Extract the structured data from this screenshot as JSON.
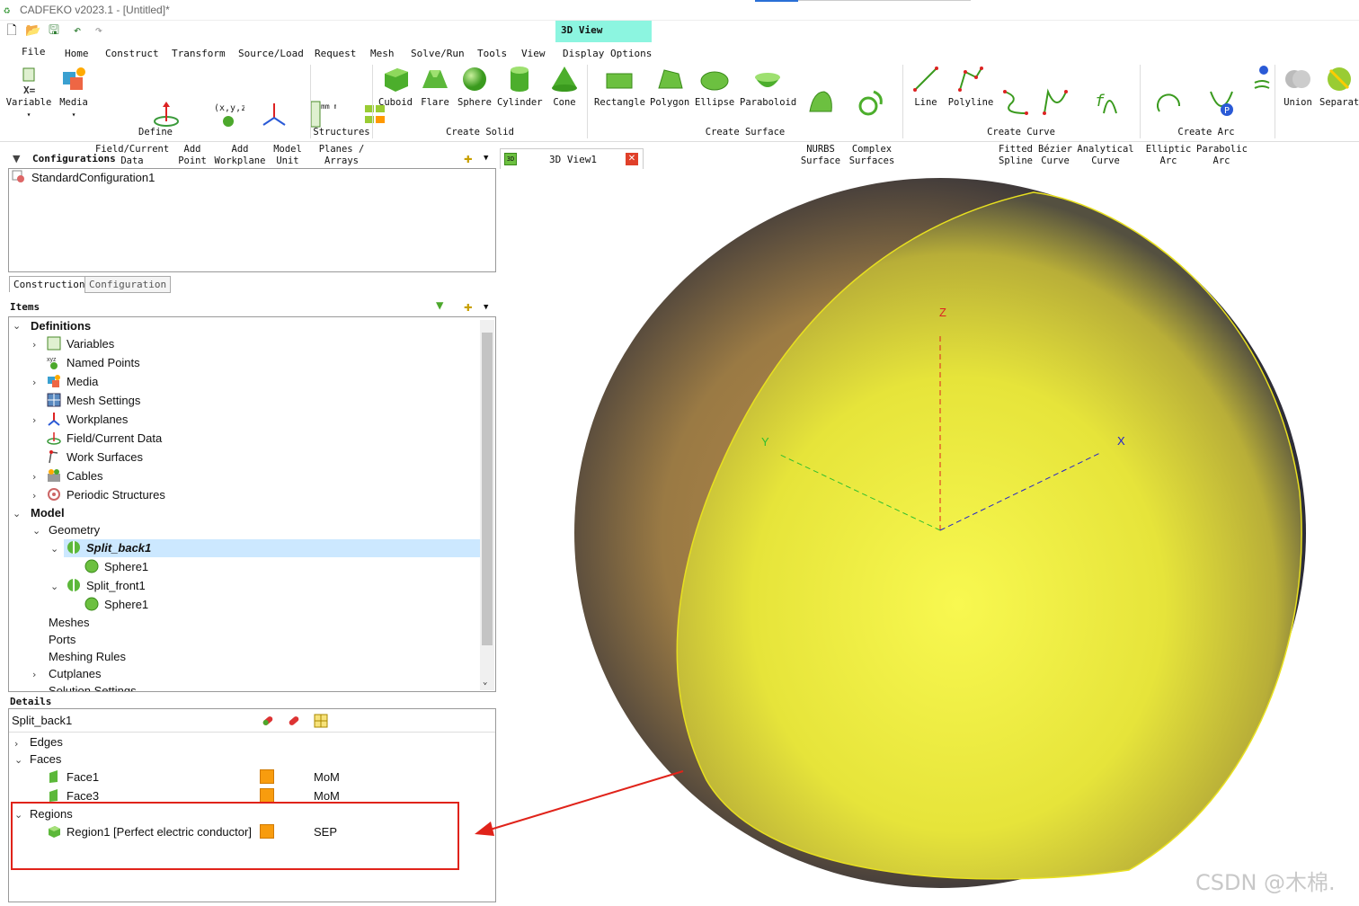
{
  "window": {
    "title": "CADFEKO v2023.1 - [Untitled]*"
  },
  "context_tab": "3D View",
  "menu": [
    "File",
    "Home",
    "Construct",
    "Transform",
    "Source/Load",
    "Request",
    "Mesh",
    "Solve/Run",
    "Tools",
    "View",
    "Display Options"
  ],
  "menu_active": "Construct",
  "ribbon": {
    "define": {
      "label": "Define",
      "buttons": [
        "Variable",
        "Media",
        "Field/Current\nData",
        "Add\nPoint",
        "Add\nWorkplane",
        "Model\nUnit"
      ]
    },
    "structures": {
      "label": "Structures",
      "buttons": [
        "Planes /\nArrays"
      ]
    },
    "create_solid": {
      "label": "Create Solid",
      "buttons": [
        "Cuboid",
        "Flare",
        "Sphere",
        "Cylinder",
        "Cone"
      ]
    },
    "create_surface": {
      "label": "Create Surface",
      "buttons": [
        "Rectangle",
        "Polygon",
        "Ellipse",
        "Paraboloid",
        "NURBS\nSurface",
        "Complex\nSurfaces"
      ]
    },
    "create_curve": {
      "label": "Create Curve",
      "buttons": [
        "Line",
        "Polyline",
        "Fitted\nSpline",
        "Bézier\nCurve",
        "Analytical\nCurve"
      ]
    },
    "create_arc": {
      "label": "Create Arc",
      "buttons": [
        "Elliptic\nArc",
        "Parabolic\nArc"
      ]
    },
    "boolean": {
      "buttons": [
        "Union",
        "Separat"
      ]
    },
    "misc_icons": {
      "x_equals": "X=",
      "xyz": "(x,y,z)",
      "units": "mm m km"
    }
  },
  "configurations": {
    "header": "Configurations",
    "items": [
      "StandardConfiguration1"
    ]
  },
  "tabs": [
    "Construction",
    "Configuration"
  ],
  "items": {
    "header": "Items",
    "tree": [
      {
        "label": "Definitions",
        "bold": true
      },
      {
        "label": "Variables"
      },
      {
        "label": "Named Points"
      },
      {
        "label": "Media"
      },
      {
        "label": "Mesh Settings"
      },
      {
        "label": "Workplanes"
      },
      {
        "label": "Field/Current Data"
      },
      {
        "label": "Work Surfaces"
      },
      {
        "label": "Cables"
      },
      {
        "label": "Periodic Structures"
      },
      {
        "label": "Model",
        "bold": true
      },
      {
        "label": "Geometry"
      },
      {
        "label": "Split_back1",
        "selected": true
      },
      {
        "label": "Sphere1"
      },
      {
        "label": "Split_front1"
      },
      {
        "label": "Sphere1"
      },
      {
        "label": "Meshes"
      },
      {
        "label": "Ports"
      },
      {
        "label": "Meshing Rules"
      },
      {
        "label": "Cutplanes"
      },
      {
        "label": "Solution Settings"
      }
    ]
  },
  "details": {
    "header": "Details",
    "object": "Split_back1",
    "rows": [
      {
        "label": "Edges"
      },
      {
        "label": "Faces"
      },
      {
        "label": "Face1",
        "solver": "MoM"
      },
      {
        "label": "Face3",
        "solver": "MoM"
      },
      {
        "label": "Regions"
      },
      {
        "label": "Region1 [Perfect electric conductor]",
        "solver": "SEP"
      }
    ]
  },
  "view": {
    "tab_label": "3D View1",
    "tab_icon_label": "3D",
    "axes": {
      "x": "X",
      "y": "Y",
      "z": "Z"
    }
  },
  "watermark": "CSDN @木棉.",
  "colors": {
    "accent": "#2a7fd6",
    "context_tab": "#8cf5e0",
    "selection": "#cce8ff",
    "swatch": "#f89c0e",
    "annotation": "#e0231a",
    "sphere": "#e8e830"
  }
}
